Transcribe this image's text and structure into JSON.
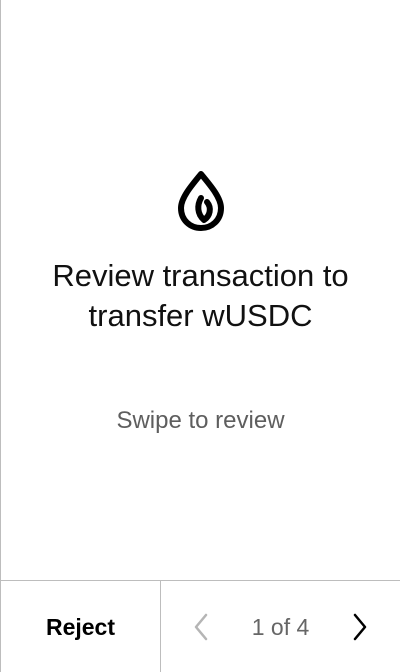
{
  "logo": {
    "icon": "sui-drop-icon",
    "color": "#000000"
  },
  "title": "Review transaction to transfer wUSDC",
  "instruction": "Swipe to review",
  "footer": {
    "reject_label": "Reject",
    "pager": {
      "text": "1 of 4",
      "prev_icon": "chevron-left-icon",
      "next_icon": "chevron-right-icon",
      "prev_enabled": false,
      "next_enabled": true
    }
  },
  "colors": {
    "text": "#111111",
    "muted_text": "#5e5e5e",
    "disabled_icon": "#b5b5b5",
    "divider": "#bdbdbd"
  }
}
